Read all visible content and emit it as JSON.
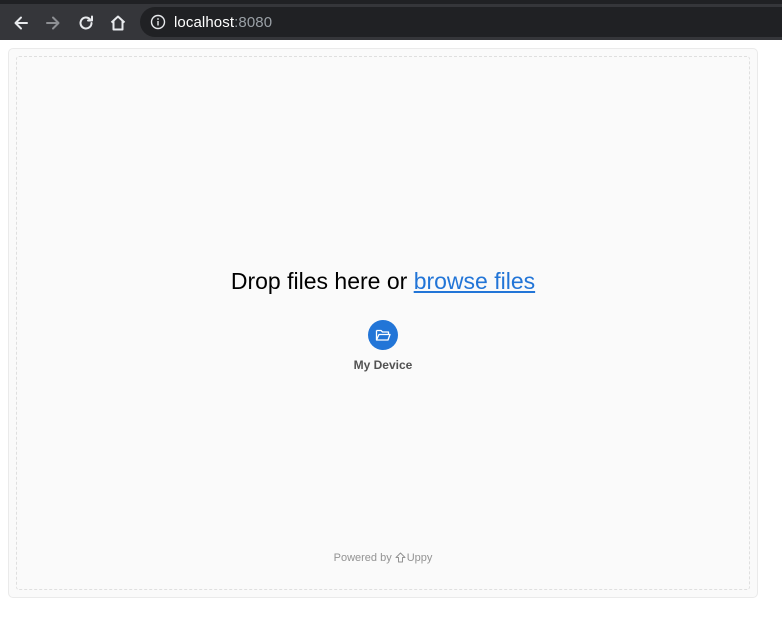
{
  "browser": {
    "url_host": "localhost",
    "url_port": ":8080",
    "icons": {
      "back": "arrow-left-icon",
      "forward": "arrow-right-icon",
      "reload": "reload-icon",
      "home": "home-icon",
      "site_info": "info-icon"
    }
  },
  "dashboard": {
    "drop_text": "Drop files here or ",
    "browse_text": "browse files",
    "device_label": "My Device",
    "powered_by": "Powered by",
    "brand": "Uppy",
    "accent_color": "#2275d7"
  }
}
